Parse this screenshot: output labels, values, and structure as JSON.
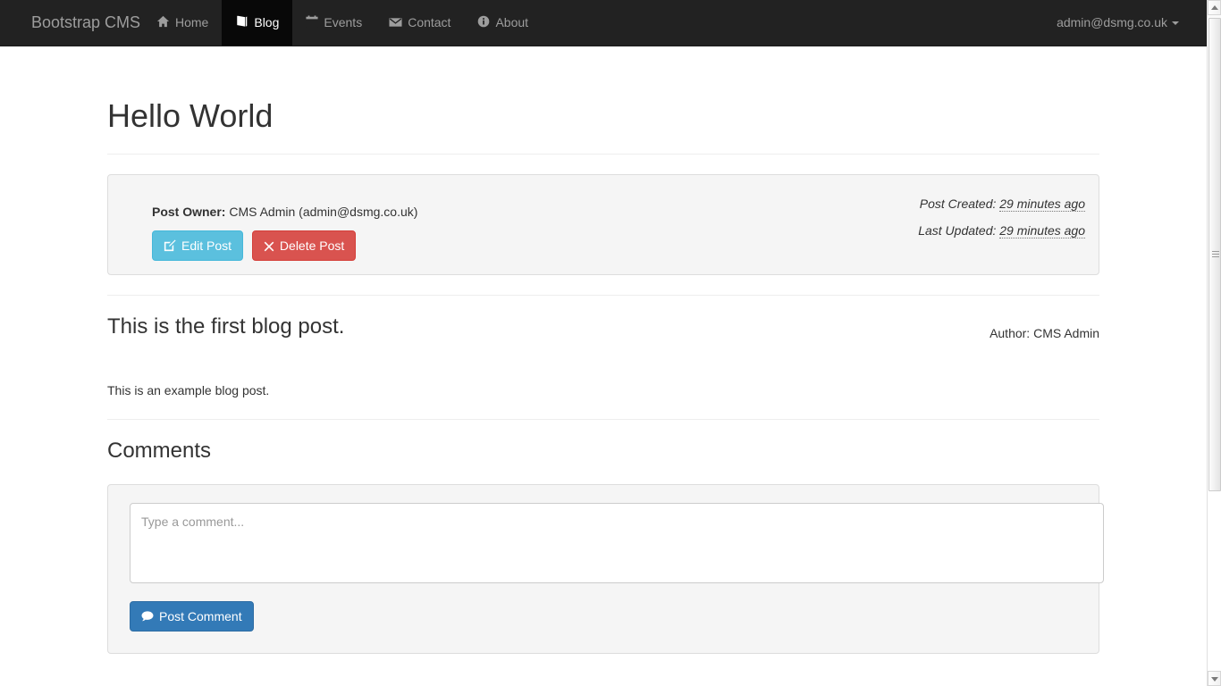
{
  "navbar": {
    "brand": "Bootstrap CMS",
    "items": [
      {
        "label": "Home",
        "icon": "home-icon",
        "active": false
      },
      {
        "label": "Blog",
        "icon": "book-icon",
        "active": true
      },
      {
        "label": "Events",
        "icon": "calendar-icon",
        "active": false
      },
      {
        "label": "Contact",
        "icon": "envelope-icon",
        "active": false
      },
      {
        "label": "About",
        "icon": "info-circle-icon",
        "active": false
      }
    ],
    "account": "admin@dsmg.co.uk",
    "background": "#222222",
    "active_background": "#080808",
    "link_color": "#9d9d9d"
  },
  "page": {
    "title": "Hello World"
  },
  "post_owner_panel": {
    "owner_label": "Post Owner:",
    "owner_value": "CMS Admin (admin@dsmg.co.uk)",
    "edit_button": "Edit Post",
    "delete_button": "Delete Post",
    "edit_button_color": "#5bc0de",
    "delete_button_color": "#d9534f",
    "created_label": "Post Created:",
    "created_value": "29 minutes ago",
    "updated_label": "Last Updated:",
    "updated_value": "29 minutes ago"
  },
  "post": {
    "heading": "This is the first blog post.",
    "author": "Author: CMS Admin",
    "body": "This is an example blog post."
  },
  "comments": {
    "title": "Comments",
    "placeholder": "Type a comment...",
    "value": "",
    "post_button": "Post Comment",
    "post_button_color": "#337ab7"
  }
}
